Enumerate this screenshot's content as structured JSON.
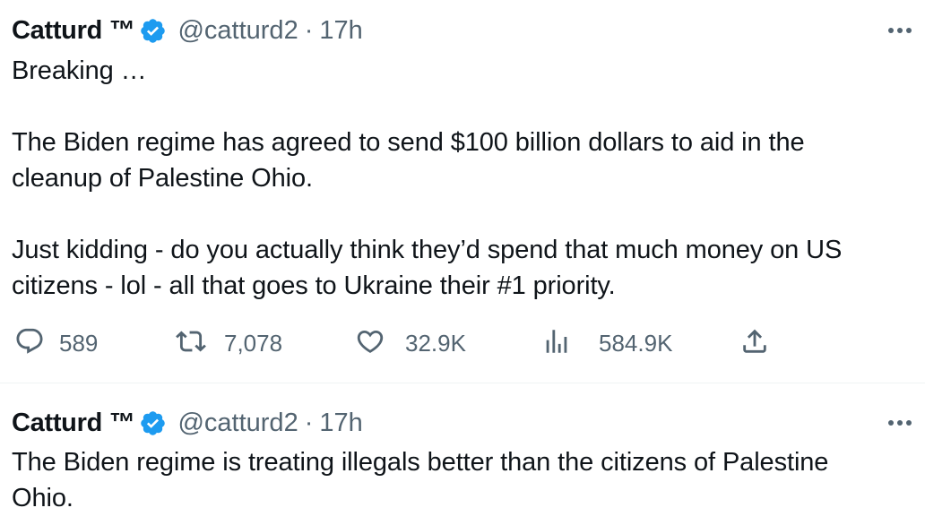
{
  "tweets": [
    {
      "display_name": "Catturd ™",
      "handle": "@catturd2",
      "separator": "·",
      "time": "17h",
      "text": "Breaking …\n\nThe Biden regime has agreed to send $100 billion dollars to aid in the\ncleanup of Palestine Ohio.\n\nJust kidding - do you actually think they’d spend that much money on US\ncitizens - lol - all that goes to Ukraine their #1 priority.",
      "replies": "589",
      "retweets": "7,078",
      "likes": "32.9K",
      "views": "584.9K"
    },
    {
      "display_name": "Catturd ™",
      "handle": "@catturd2",
      "separator": "·",
      "time": "17h",
      "text": "The Biden regime is treating illegals better than the citizens of Palestine\nOhio."
    }
  ],
  "icons": {
    "verified": "verified-badge-icon",
    "more": "more-icon",
    "reply": "reply-icon",
    "retweet": "retweet-icon",
    "like": "like-icon",
    "views": "views-icon",
    "share": "share-icon"
  },
  "colors": {
    "verified_blue": "#1d9bf0",
    "text_primary": "#0f1419",
    "text_secondary": "#536471",
    "divider": "#eff3f4"
  }
}
